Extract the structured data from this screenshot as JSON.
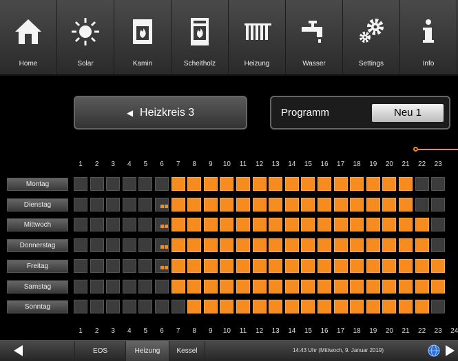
{
  "nav": [
    {
      "label": "Home",
      "icon": "home-icon"
    },
    {
      "label": "Solar",
      "icon": "sun-icon"
    },
    {
      "label": "Kamin",
      "icon": "fireplace-icon"
    },
    {
      "label": "Scheitholz",
      "icon": "wood-stove-icon"
    },
    {
      "label": "Heizung",
      "icon": "radiator-icon"
    },
    {
      "label": "Wasser",
      "icon": "faucet-icon"
    },
    {
      "label": "Settings",
      "icon": "gears-icon"
    },
    {
      "label": "Info",
      "icon": "info-icon"
    }
  ],
  "heating_circuit": {
    "label": "Heizkreis 3"
  },
  "program": {
    "label": "Programm",
    "value": "Neu 1"
  },
  "hours_top": [
    "1",
    "2",
    "3",
    "4",
    "5",
    "6",
    "7",
    "8",
    "9",
    "10",
    "11",
    "12",
    "13",
    "14",
    "15",
    "16",
    "17",
    "18",
    "19",
    "20",
    "21",
    "22",
    "23"
  ],
  "hours_bottom": [
    "1",
    "2",
    "3",
    "4",
    "5",
    "6",
    "7",
    "8",
    "9",
    "10",
    "11",
    "12",
    "13",
    "14",
    "15",
    "16",
    "17",
    "18",
    "19",
    "20",
    "21",
    "22",
    "23",
    "24"
  ],
  "schedule": [
    {
      "day": "Montag",
      "on_from": 7,
      "on_to": 21,
      "partial": []
    },
    {
      "day": "Dienstag",
      "on_from": 7,
      "on_to": 21,
      "partial": [
        6
      ]
    },
    {
      "day": "Mittwoch",
      "on_from": 7,
      "on_to": 22,
      "partial": [
        6
      ]
    },
    {
      "day": "Donnerstag",
      "on_from": 7,
      "on_to": 22,
      "partial": [
        6
      ]
    },
    {
      "day": "Freitag",
      "on_from": 7,
      "on_to": 23,
      "partial": [
        6
      ]
    },
    {
      "day": "Samstag",
      "on_from": 7,
      "on_to": 23,
      "partial": []
    },
    {
      "day": "Sonntag",
      "on_from": 8,
      "on_to": 22,
      "partial": []
    }
  ],
  "colors": {
    "accent": "#f68b1f",
    "cell_off": "#3c3c3c"
  },
  "bottom": {
    "tabs": [
      "EOS",
      "Heizung",
      "Kessel"
    ],
    "active_tab": "Heizung",
    "status_time": "14:43 Uhr (Mittwoch, 9. Januar 2019)"
  }
}
